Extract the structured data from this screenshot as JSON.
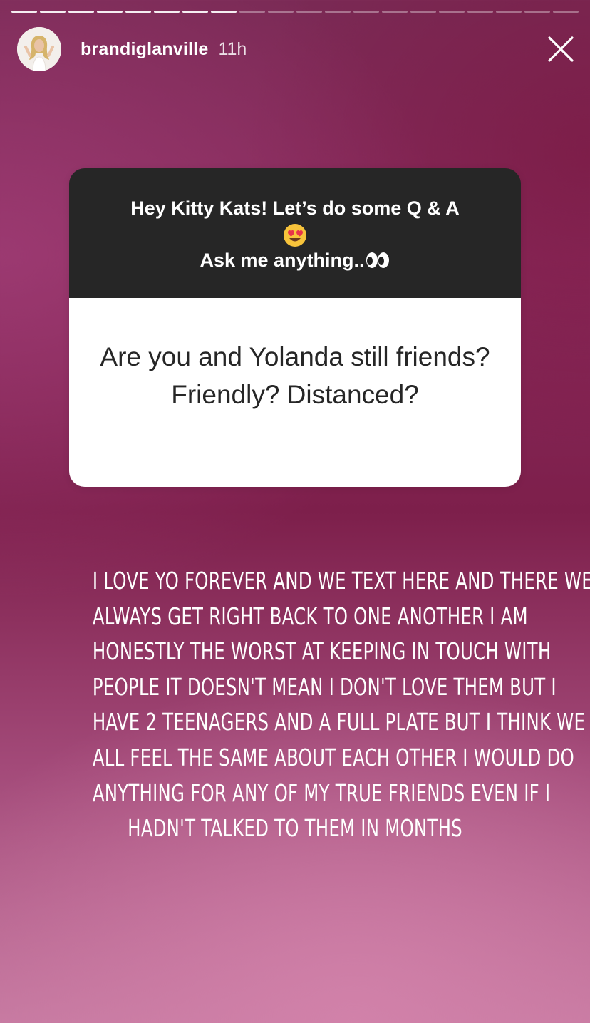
{
  "story": {
    "progress": {
      "total_segments": 20,
      "completed_segments": 8
    },
    "user": {
      "username": "brandiglanville",
      "time_ago": "11h"
    },
    "question_sticker": {
      "prompt_line1": "Hey Kitty Kats! Let’s do some Q & A",
      "prompt_emoji1": "heart-eyes-emoji",
      "prompt_line3": "Ask me anything..",
      "prompt_emoji2": "eyes-emoji",
      "question": "Are you and Yolanda still friends? Friendly? Distanced?"
    },
    "answer_lines": [
      "I LOVE YO FOREVER AND WE TEXT HERE AND THERE WE",
      "ALWAYS GET RIGHT BACK TO ONE ANOTHER I AM",
      "HONESTLY THE WORST AT KEEPING IN TOUCH WITH",
      "PEOPLE IT DOESN'T MEAN I DON'T LOVE THEM BUT I",
      "HAVE 2 TEENAGERS AND A FULL PLATE BUT I THINK WE",
      "ALL FEEL THE SAME ABOUT EACH OTHER I WOULD DO",
      "ANYTHING FOR ANY OF MY TRUE FRIENDS EVEN IF I",
      "HADN'T TALKED TO THEM IN MONTHS"
    ],
    "colors": {
      "sticker_header": "#262626",
      "sticker_body": "#ffffff",
      "background_top": "#7a2a55",
      "background_bottom": "#c4789f"
    }
  }
}
